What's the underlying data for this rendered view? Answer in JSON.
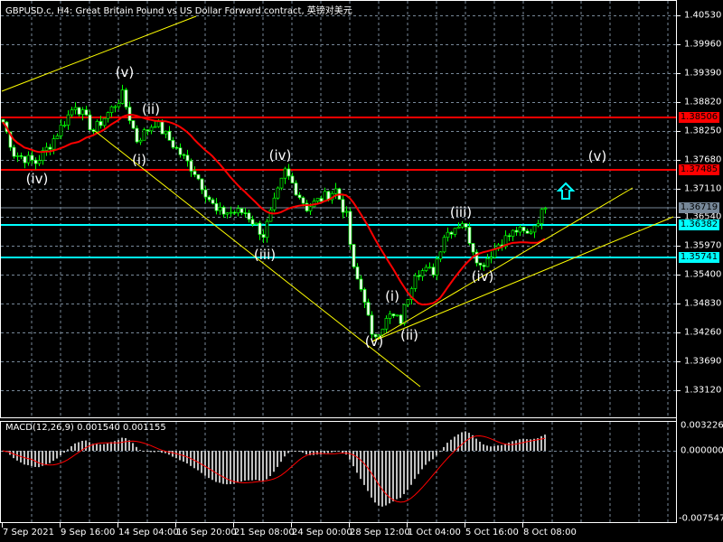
{
  "header": {
    "title": "GBPUSD.c, H4:  Great Britain Pound vs US Dollar Forward contract, 英镑对美元"
  },
  "colors": {
    "background": "#000000",
    "candle": "#00ff00",
    "candle_body": "#ffffff",
    "ma": "#ff0000",
    "resistance": "#ff0000",
    "support": "#00ffff",
    "bid_line": "#778899",
    "trendline": "#ffff00",
    "grid": "#778899",
    "macd_hist": "#c0c0c0",
    "macd_signal": "#ff0000"
  },
  "price_axis": {
    "ticks": [
      "1.40530",
      "1.39960",
      "1.39390",
      "1.38820",
      "1.38250",
      "1.37680",
      "1.37110",
      "1.36540",
      "1.35970",
      "1.35400",
      "1.34830",
      "1.34260",
      "1.33690",
      "1.33120"
    ],
    "range": [
      1.3312,
      1.4053
    ]
  },
  "levels": [
    {
      "label": "1.38506",
      "value": 1.38506,
      "kind": "resistance"
    },
    {
      "label": "1.37485",
      "value": 1.37485,
      "kind": "resistance"
    },
    {
      "label": "1.36719",
      "value": 1.36719,
      "kind": "bid"
    },
    {
      "label": "1.36382",
      "value": 1.36382,
      "kind": "support"
    },
    {
      "label": "1.35741",
      "value": 1.35741,
      "kind": "support"
    }
  ],
  "time_axis": {
    "ticks": [
      "7 Sep 2021",
      "9 Sep 16:00",
      "14 Sep 04:00",
      "16 Sep 20:00",
      "21 Sep 08:00",
      "24 Sep 00:00",
      "28 Sep 12:00",
      "1 Oct 04:00",
      "5 Oct 16:00",
      "8 Oct 08:00"
    ]
  },
  "waves": [
    "(iv)",
    "(v)",
    "(ii)",
    "(i)",
    "(iii)",
    "(iv)",
    "(v)",
    "(i)",
    "(ii)",
    "(iii)",
    "(iv)",
    "(v)"
  ],
  "arrow": {
    "icon": "up-arrow-icon",
    "color": "#00ffff"
  },
  "macd": {
    "label": "MACD(12,26,9) 0.001540 0.001155",
    "ticks": [
      "0.003226",
      "0.000000",
      "-0.007547"
    ],
    "range": [
      -0.007547,
      0.003226
    ]
  },
  "chart_data": {
    "type": "candlestick",
    "symbol": "GBPUSD.c",
    "timeframe": "H4",
    "price_path": [
      [
        0,
        1.38423
      ],
      [
        3,
        1.37798
      ],
      [
        9,
        1.3762
      ],
      [
        13,
        1.37977
      ],
      [
        20,
        1.3878
      ],
      [
        25,
        1.38245
      ],
      [
        33,
        1.3895
      ],
      [
        37,
        1.38066
      ],
      [
        42,
        1.38423
      ],
      [
        47,
        1.37977
      ],
      [
        53,
        1.37441
      ],
      [
        59,
        1.36638
      ],
      [
        67,
        1.36638
      ],
      [
        72,
        1.36191
      ],
      [
        78,
        1.37441
      ],
      [
        84,
        1.36727
      ],
      [
        92,
        1.37084
      ],
      [
        95,
        1.36548
      ],
      [
        97,
        1.35477
      ],
      [
        100,
        1.34941
      ],
      [
        102,
        1.34138
      ],
      [
        107,
        1.34584
      ],
      [
        110,
        1.34495
      ],
      [
        114,
        1.35477
      ],
      [
        119,
        1.35477
      ],
      [
        122,
        1.36191
      ],
      [
        127,
        1.36459
      ],
      [
        132,
        1.35566
      ],
      [
        137,
        1.36013
      ],
      [
        142,
        1.36281
      ],
      [
        145,
        1.36191
      ],
      [
        150,
        1.36719
      ]
    ],
    "last_price": 1.36719
  }
}
